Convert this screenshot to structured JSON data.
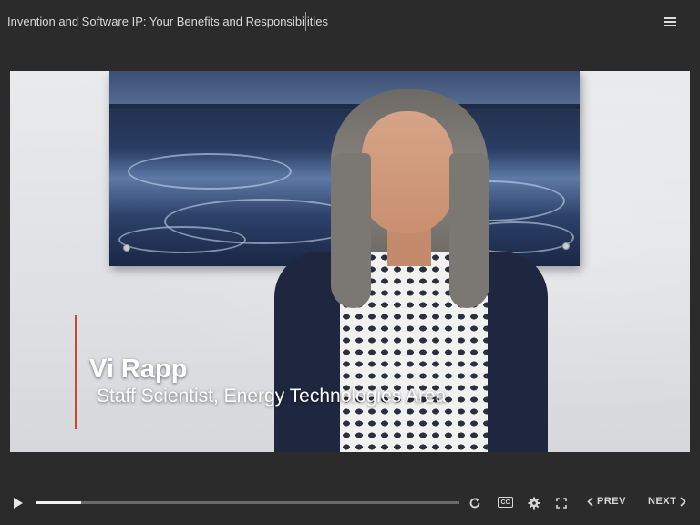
{
  "header": {
    "course_title": "Invention and Software IP: Your Benefits and Responsibilities",
    "menu_icon": "hamburger-menu-icon"
  },
  "video": {
    "speaker_name": "Vi Rapp",
    "speaker_role": "Staff Scientist, Energy Technologies Area",
    "accent_color": "#c8473a"
  },
  "controls": {
    "play_icon": "play-icon",
    "progress": 0.105,
    "replay_icon": "replay-icon",
    "cc_label": "CC",
    "settings_icon": "gear-icon",
    "fullscreen_icon": "fullscreen-icon",
    "prev_label": "PREV",
    "next_label": "NEXT"
  }
}
